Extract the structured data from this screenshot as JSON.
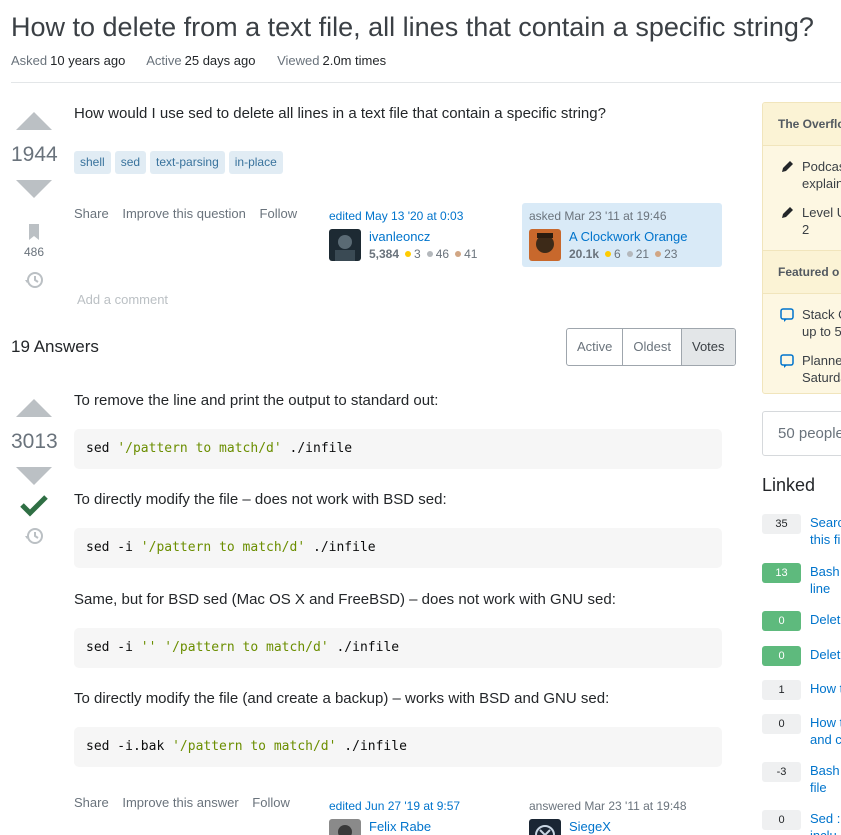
{
  "question": {
    "title": "How to delete from a text file, all lines that contain a specific string?",
    "asked_label": "Asked",
    "asked_value": "10 years ago",
    "active_label": "Active",
    "active_value": "25 days ago",
    "viewed_label": "Viewed",
    "viewed_value": "2.0m times",
    "score": "1944",
    "bookmarks": "486",
    "body": "How would I use sed to delete all lines in a text file that contain a specific string?",
    "tags": [
      "shell",
      "sed",
      "text-parsing",
      "in-place"
    ],
    "menu": {
      "share": "Share",
      "improve": "Improve this question",
      "follow": "Follow"
    },
    "editor": {
      "action": "edited May 13 '20 at 0:03",
      "name": "ivanleoncz",
      "rep": "5,384",
      "gold": "3",
      "silver": "46",
      "bronze": "41"
    },
    "owner": {
      "action": "asked Mar 23 '11 at 19:46",
      "name": "A Clockwork Orange",
      "rep": "20.1k",
      "gold": "6",
      "silver": "21",
      "bronze": "23"
    },
    "add_comment": "Add a comment"
  },
  "answers_header": {
    "count": "19",
    "label": "Answers"
  },
  "sort_tabs": [
    "Active",
    "Oldest",
    "Votes"
  ],
  "answer": {
    "score": "3013",
    "p1": "To remove the line and print the output to standard out:",
    "code1": {
      "cmd": "sed ",
      "str": "'/pattern to match/d'",
      "rest": " ./infile"
    },
    "p2": "To directly modify the file – does not work with BSD sed:",
    "code2": {
      "cmd": "sed -i ",
      "str": "'/pattern to match/d'",
      "rest": " ./infile"
    },
    "p3": "Same, but for BSD sed (Mac OS X and FreeBSD) – does not work with GNU sed:",
    "code3": {
      "cmd": "sed -i ",
      "str1": "''",
      "sp": " ",
      "str": "'/pattern to match/d'",
      "rest": " ./infile"
    },
    "p4": "To directly modify the file (and create a backup) – works with BSD and GNU sed:",
    "code4": {
      "cmd": "sed -i.bak ",
      "str": "'/pattern to match/d'",
      "rest": " ./infile"
    },
    "menu": {
      "share": "Share",
      "improve": "Improve this answer",
      "follow": "Follow"
    },
    "editor": {
      "action": "edited Jun 27 '19 at 9:57",
      "name": "Felix Rabe"
    },
    "owner": {
      "action": "answered Mar 23 '11 at 19:48",
      "name": "SiegeX"
    }
  },
  "sidebar": {
    "blog_header": "The Overflo",
    "blog_items": [
      {
        "icon": "pencil-icon",
        "text1": "Podcas",
        "text2": "explain"
      },
      {
        "icon": "pencil-icon",
        "text1": "Level U",
        "text2": "2"
      }
    ],
    "featured_header": "Featured o",
    "featured_items": [
      {
        "icon": "chat-icon",
        "text1": "Stack O",
        "text2": "up to 5"
      },
      {
        "icon": "chat-icon",
        "text1": "Planne",
        "text2": "Saturda"
      }
    ],
    "people": "50 people"
  },
  "linked": {
    "header": "Linked",
    "items": [
      {
        "score": "35",
        "accepted": false,
        "line1": "Searc",
        "line2": "this fi"
      },
      {
        "score": "13",
        "accepted": true,
        "line1": "Bash",
        "line2": "line"
      },
      {
        "score": "0",
        "accepted": true,
        "line1": "Delet",
        "line2": ""
      },
      {
        "score": "0",
        "accepted": true,
        "line1": "Delet",
        "line2": ""
      },
      {
        "score": "1",
        "accepted": false,
        "line1": "How t",
        "line2": ""
      },
      {
        "score": "0",
        "accepted": false,
        "line1": "How t",
        "line2": "and c"
      },
      {
        "score": "-3",
        "accepted": false,
        "line1": "Bash",
        "line2": "file"
      },
      {
        "score": "0",
        "accepted": false,
        "line1": "Sed :",
        "line2": "inclu"
      }
    ]
  },
  "colors": {
    "accent": "#0074cc",
    "accepted": "#2f6f44",
    "tag_bg": "#e1ecf4",
    "sidebar_bg": "#fdf7e2"
  }
}
